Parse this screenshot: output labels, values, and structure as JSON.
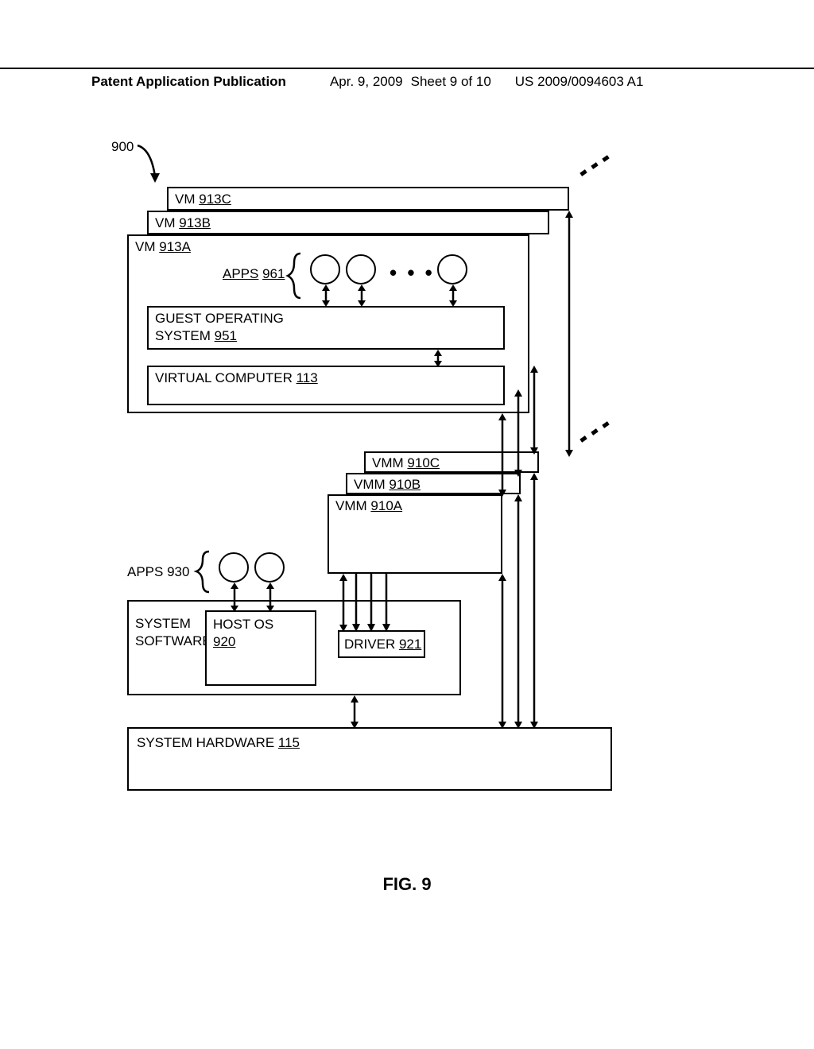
{
  "header": {
    "publication_label": "Patent Application Publication",
    "date": "Apr. 9, 2009",
    "sheet": "Sheet 9 of 10",
    "patent_no": "US 2009/0094603 A1"
  },
  "figure_ref": "900",
  "blocks": {
    "vm_a": {
      "label": "VM",
      "num": "913A"
    },
    "vm_b": {
      "label": "VM",
      "num": "913B"
    },
    "vm_c": {
      "label": "VM",
      "num": "913C"
    },
    "apps_961": {
      "label": "APPS",
      "num": "961"
    },
    "guest_os": {
      "label1": "GUEST OPERATING",
      "label2": "SYSTEM",
      "num": "951"
    },
    "virtual_computer": {
      "label": "VIRTUAL COMPUTER",
      "num": "113"
    },
    "vmm_a": {
      "label": "VMM",
      "num": "910A"
    },
    "vmm_b": {
      "label": "VMM",
      "num": "910B"
    },
    "vmm_c": {
      "label": "VMM",
      "num": "910C"
    },
    "apps_930": {
      "label": "APPS",
      "num": "930"
    },
    "system_software_box": {
      "label1": "SYSTEM",
      "label2": "SOFTWARE"
    },
    "host_os": {
      "label": "HOST OS",
      "num": "920"
    },
    "driver": {
      "label": "DRIVER",
      "num": "921"
    },
    "hardware": {
      "label": "SYSTEM HARDWARE",
      "num": "115"
    }
  },
  "figure_label": "FIG. 9"
}
